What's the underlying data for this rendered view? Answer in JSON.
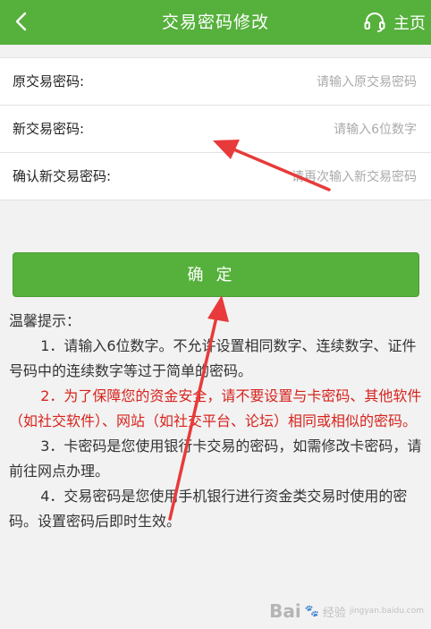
{
  "header": {
    "title": "交易密码修改",
    "home_label": "主页"
  },
  "form": {
    "old_label": "原交易密码:",
    "old_placeholder": "请输入原交易密码",
    "new_label": "新交易密码:",
    "new_placeholder": "请输入6位数字",
    "confirm_label": "确认新交易密码:",
    "confirm_placeholder": "请再次输入新交易密码"
  },
  "submit_label": "确定",
  "tips": {
    "heading": "温馨提示：",
    "items": [
      "1．请输入6位数字。不允许设置相同数字、连续数字、证件号码中的连续数字等过于简单的密码。",
      "2．为了保障您的资金安全，请不要设置与卡密码、其他软件（如社交软件）、网站（如社交平台、论坛）相同或相似的密码。",
      "3．卡密码是您使用银行卡交易的密码，如需修改卡密码，请前往网点办理。",
      "4．交易密码是您使用手机银行进行资金类交易时使用的密码。设置密码后即时生效。"
    ]
  },
  "watermark": {
    "brand": "Bai",
    "suffix": "经验",
    "site": "jingyan.baidu.com"
  },
  "colors": {
    "accent_green": "#56b03c",
    "warning_red": "#d7231d",
    "annotation_arrow": "#e83a3a"
  }
}
